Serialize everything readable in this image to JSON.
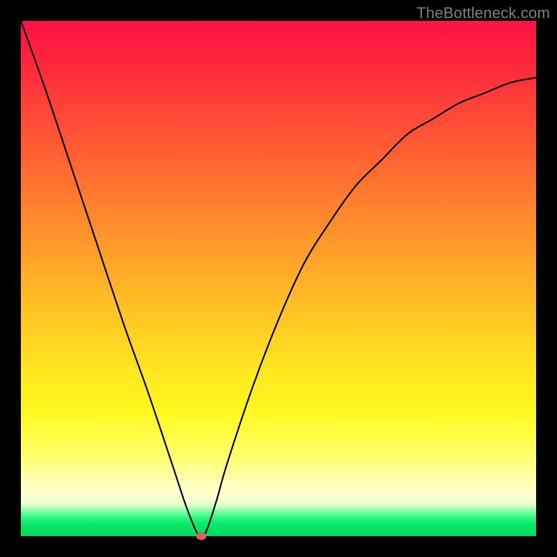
{
  "brand": "TheBottleneck.com",
  "colors": {
    "background": "#000000",
    "curve": "#000000",
    "marker": "#d9625a",
    "brand_text": "#808080"
  },
  "chart_data": {
    "type": "line",
    "title": "",
    "xlabel": "",
    "ylabel": "",
    "xlim": [
      0,
      100
    ],
    "ylim": [
      0,
      100
    ],
    "x": [
      0,
      5,
      10,
      15,
      20,
      25,
      30,
      32,
      34,
      35,
      36,
      38,
      40,
      45,
      50,
      55,
      60,
      65,
      70,
      75,
      80,
      85,
      90,
      95,
      100
    ],
    "y": [
      100,
      86,
      71,
      56,
      41,
      27,
      12,
      6,
      1,
      0,
      1,
      7,
      14,
      29,
      42,
      53,
      61,
      68,
      73,
      78,
      81,
      84,
      86,
      88,
      89
    ],
    "marker": {
      "x": 35,
      "y": 0
    },
    "grid": false,
    "legend": false,
    "annotations": []
  }
}
